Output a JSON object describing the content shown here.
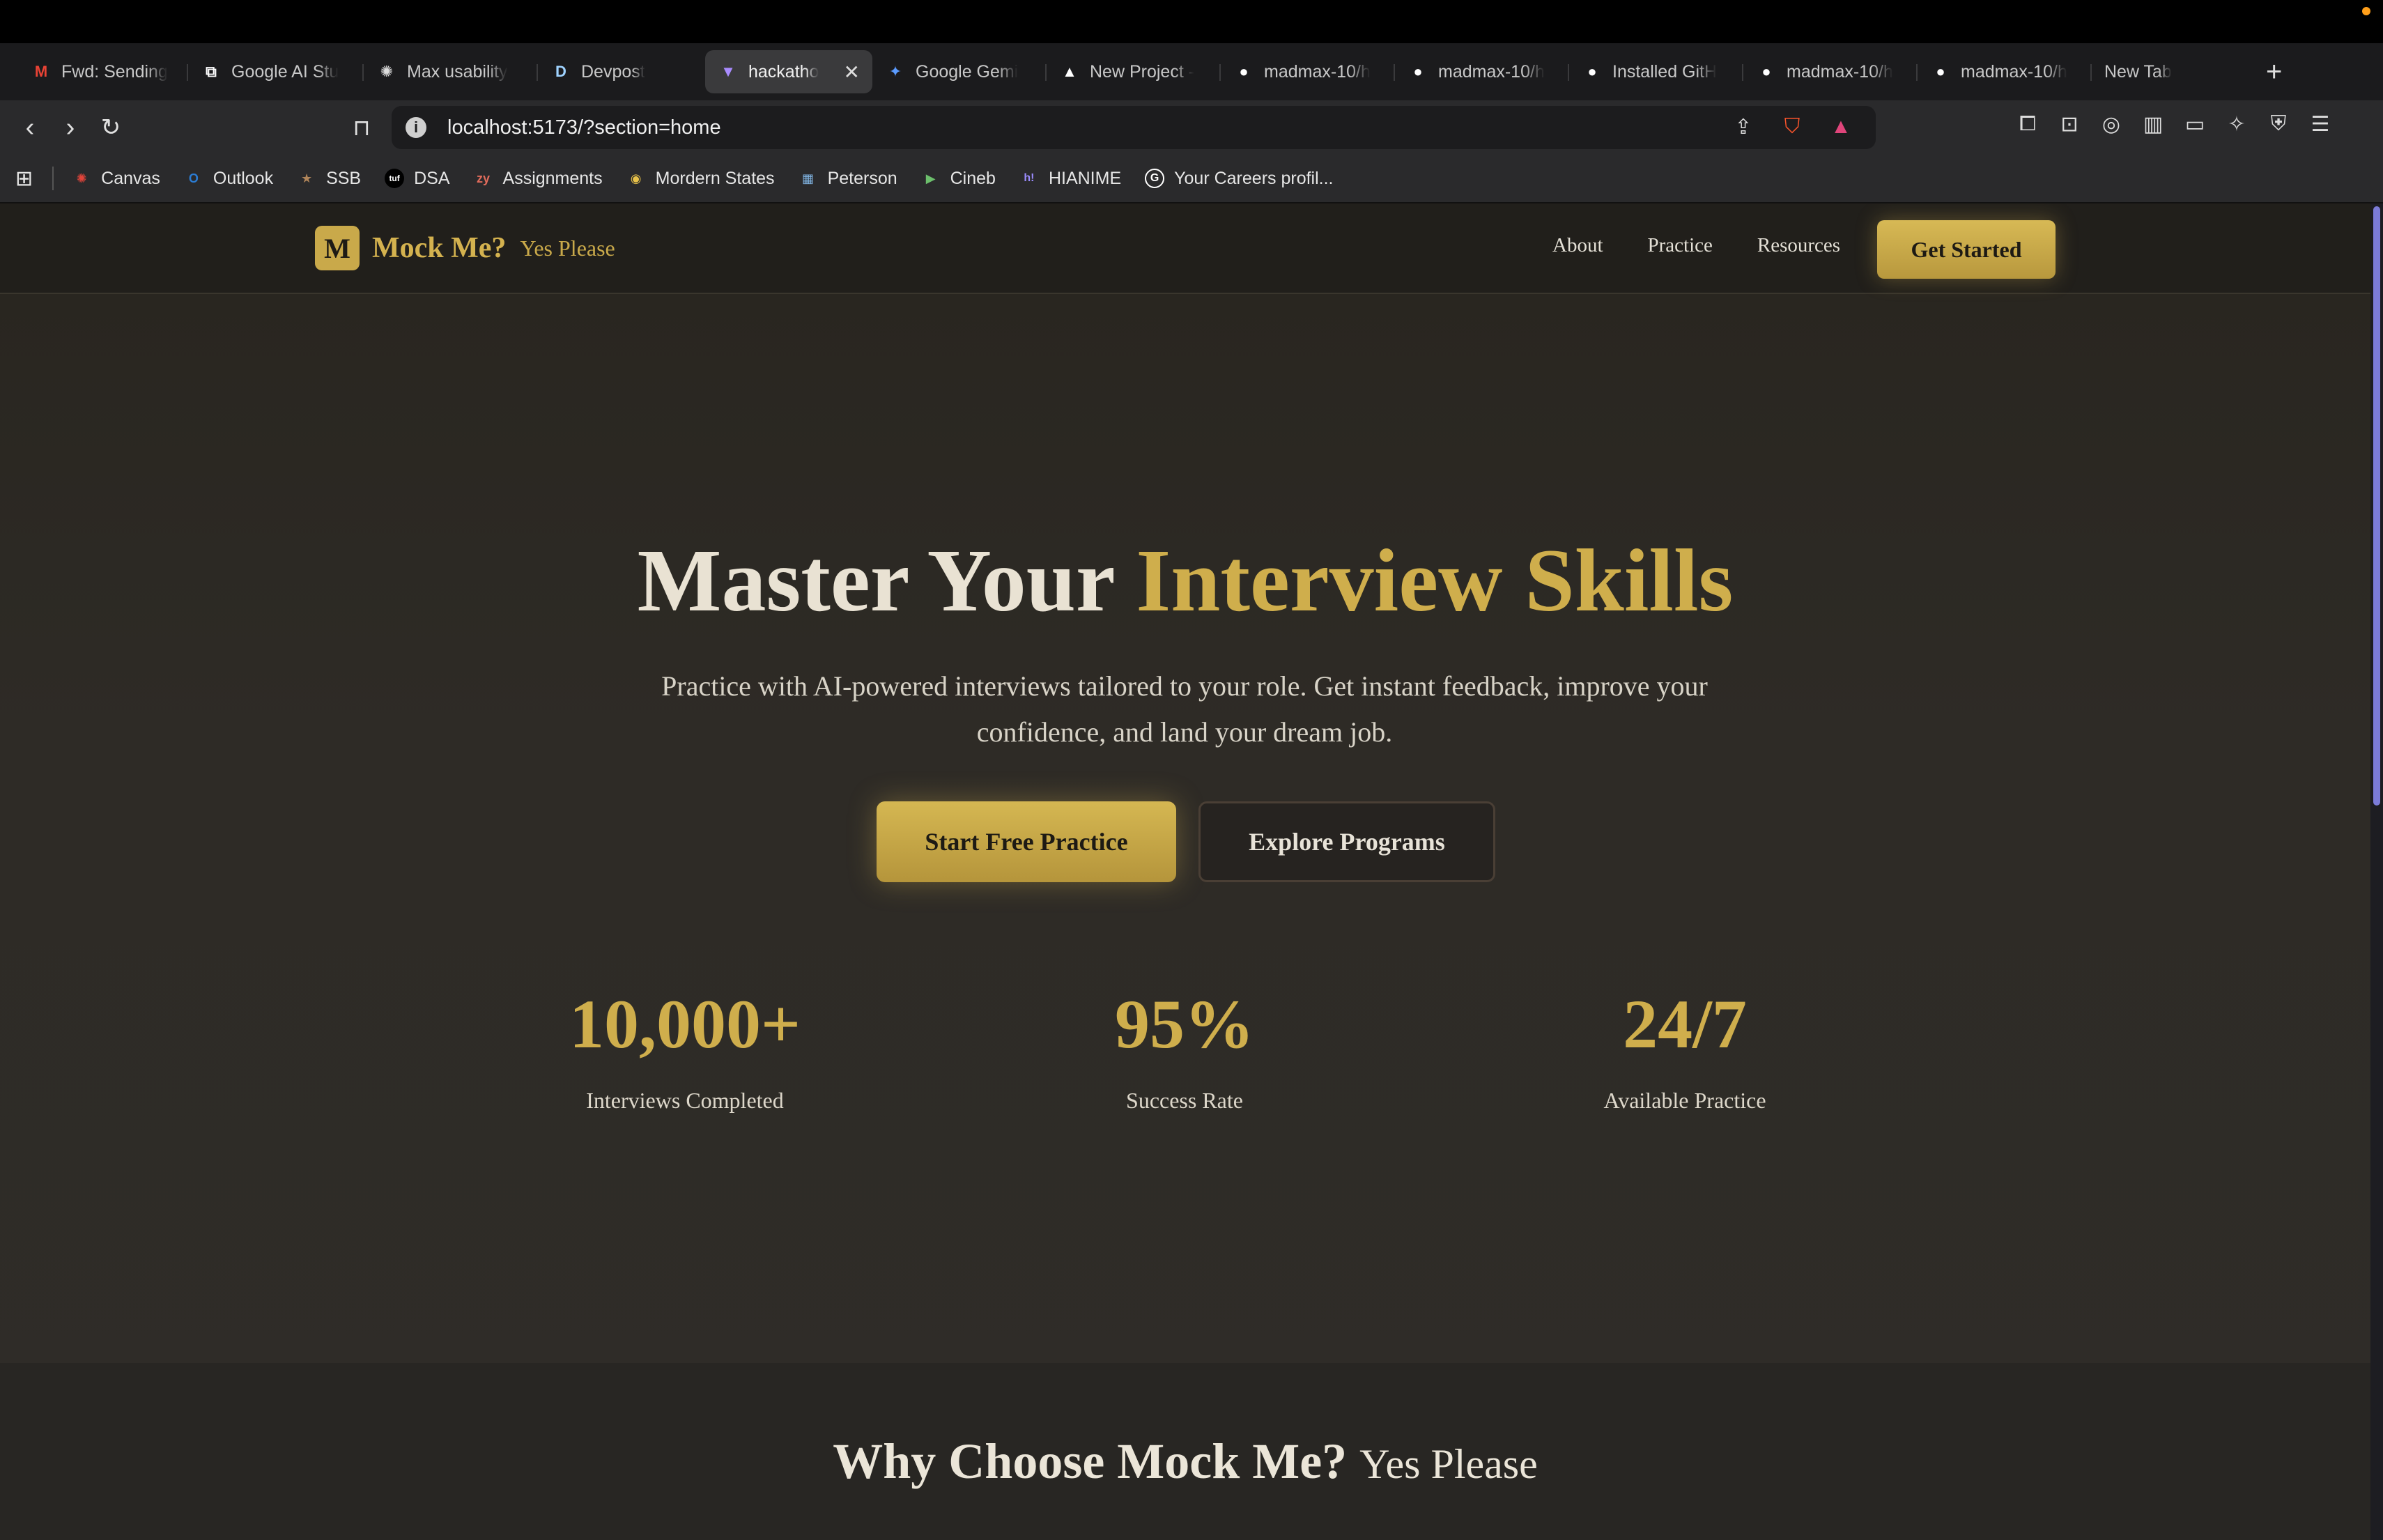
{
  "browser": {
    "tabs": [
      {
        "title": "Fwd: Sending",
        "icon": "gmail-icon",
        "fav": "M",
        "color": "#ea4335"
      },
      {
        "title": "Google AI Stu",
        "icon": "ai-studio-icon",
        "fav": "⧉",
        "color": "#ffffff"
      },
      {
        "title": "Max usability",
        "icon": "openai-icon",
        "fav": "✺",
        "color": "#dddddd"
      },
      {
        "title": "Devpost",
        "icon": "devpost-icon",
        "fav": "D",
        "color": "#9fd3ff"
      },
      {
        "title": "hackatho",
        "icon": "vite-icon",
        "fav": "▼",
        "color": "#a98bff",
        "active": true
      },
      {
        "title": "Google Gemi",
        "icon": "gemini-icon",
        "fav": "✦",
        "color": "#5b9bff"
      },
      {
        "title": "New Project -",
        "icon": "vercel-icon",
        "fav": "▲",
        "color": "#ffffff"
      },
      {
        "title": "madmax-10/h",
        "icon": "github-icon",
        "fav": "●",
        "color": "#ffffff"
      },
      {
        "title": "madmax-10/h",
        "icon": "github-icon",
        "fav": "●",
        "color": "#ffffff"
      },
      {
        "title": "Installed GitH",
        "icon": "github-icon",
        "fav": "●",
        "color": "#ffffff"
      },
      {
        "title": "madmax-10/h",
        "icon": "github-icon",
        "fav": "●",
        "color": "#ffffff"
      },
      {
        "title": "madmax-10/h",
        "icon": "github-icon",
        "fav": "●",
        "color": "#ffffff"
      },
      {
        "title": "New Tab",
        "icon": "",
        "fav": "",
        "color": "#ffffff"
      }
    ],
    "url": "localhost:5173/?section=home",
    "bookmarks": [
      {
        "label": "Canvas",
        "icon": "canvas-icon",
        "fav": "✺",
        "color": "#e2443a"
      },
      {
        "label": "Outlook",
        "icon": "outlook-icon",
        "fav": "O",
        "color": "#2b7cd3"
      },
      {
        "label": "SSB",
        "icon": "ssb-icon",
        "fav": "★",
        "color": "#b0855a"
      },
      {
        "label": "DSA",
        "icon": "dsa-icon",
        "fav": "tuf",
        "color": "#ffffff"
      },
      {
        "label": "Assignments",
        "icon": "zybooks-icon",
        "fav": "zy",
        "color": "#e06b5b"
      },
      {
        "label": "Mordern States",
        "icon": "modern-states-icon",
        "fav": "◉",
        "color": "#e8c24a"
      },
      {
        "label": "Peterson",
        "icon": "peterson-icon",
        "fav": "▦",
        "color": "#7fb2e0"
      },
      {
        "label": "Cineb",
        "icon": "cineb-icon",
        "fav": "▶",
        "color": "#6cbf6c"
      },
      {
        "label": "HIANIME",
        "icon": "hianime-icon",
        "fav": "h!",
        "color": "#9b8cff"
      },
      {
        "label": "Your Careers profil...",
        "icon": "google-icon",
        "fav": "G",
        "color": "#ffffff"
      }
    ]
  },
  "site": {
    "logo_letter": "M",
    "brand": "Mock Me?",
    "brand_sub": "Yes Please",
    "nav": [
      "About",
      "Practice",
      "Resources"
    ],
    "cta": "Get Started"
  },
  "hero": {
    "title_plain": "Master Your",
    "title_gold": "Interview Skills",
    "subtitle_line1": "Practice with AI-powered interviews tailored to your role. Get instant feedback, improve your",
    "subtitle_line2": "confidence, and land your dream job.",
    "primary_button": "Start Free Practice",
    "secondary_button": "Explore Programs"
  },
  "stats": [
    {
      "value": "10,000+",
      "label": "Interviews Completed"
    },
    {
      "value": "95%",
      "label": "Success Rate"
    },
    {
      "value": "24/7",
      "label": "Available Practice"
    }
  ],
  "why": {
    "title": "Why Choose Mock Me?",
    "title_sub": "Yes Please"
  }
}
